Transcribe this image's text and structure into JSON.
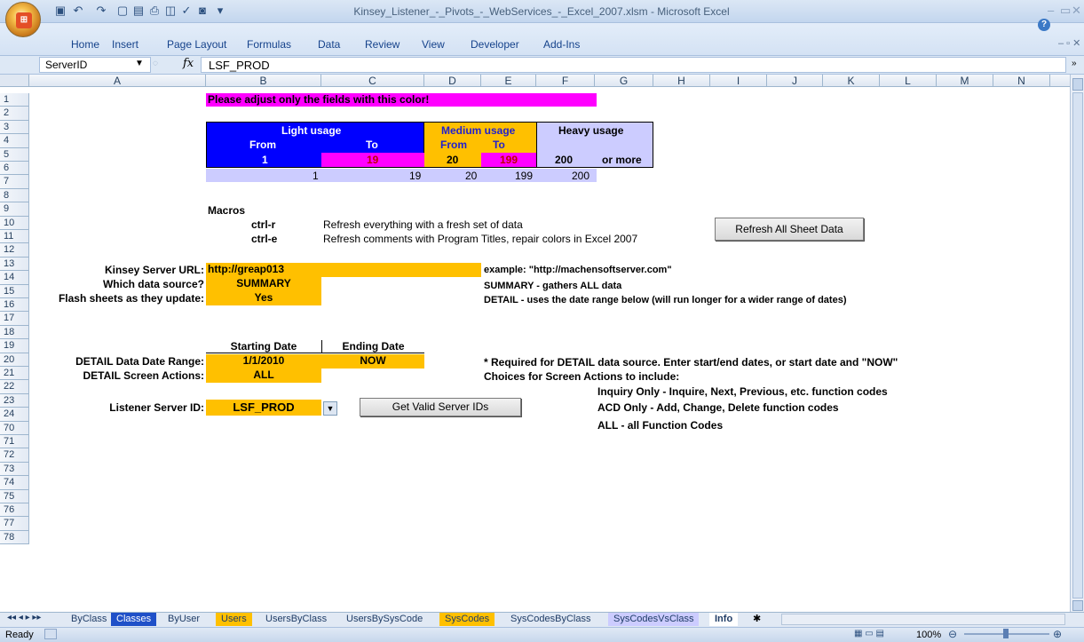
{
  "window": {
    "title": "Kinsey_Listener_-_Pivots_-_WebServices_-_Excel_2007.xlsm - Microsoft Excel",
    "controls": [
      "–",
      "▭",
      "✕"
    ]
  },
  "ribbon": {
    "tabs": [
      "Home",
      "Insert",
      "Page Layout",
      "Formulas",
      "Data",
      "Review",
      "View",
      "Developer",
      "Add-Ins"
    ]
  },
  "formula_bar": {
    "name_box": "ServerID",
    "fx": "fx",
    "formula": "LSF_PROD"
  },
  "columns": [
    "A",
    "B",
    "C",
    "D",
    "E",
    "F",
    "G",
    "H",
    "I",
    "J",
    "K",
    "L",
    "M",
    "N"
  ],
  "rows": [
    "1",
    "2",
    "3",
    "4",
    "5",
    "6",
    "7",
    "8",
    "9",
    "10",
    "11",
    "12",
    "13",
    "14",
    "15",
    "16",
    "17",
    "18",
    "19",
    "20",
    "21",
    "22",
    "23",
    "24",
    "70",
    "71",
    "72",
    "73",
    "74",
    "75",
    "76",
    "77",
    "78"
  ],
  "sheet": {
    "notice": "Please adjust only the fields with this color!",
    "usage": {
      "light_header": "Light usage",
      "medium_header": "Medium usage",
      "heavy_header": "Heavy usage",
      "from": "From",
      "to": "To",
      "light_from": "1",
      "light_to": "19",
      "medium_from": "20",
      "medium_to": "199",
      "heavy_from": "200",
      "or_more": "or more",
      "row6": [
        "1",
        "19",
        "20",
        "199",
        "200"
      ]
    },
    "macros": {
      "label": "Macros",
      "items": [
        {
          "key": "ctrl-r",
          "desc": "Refresh everything with a fresh set of data"
        },
        {
          "key": "ctrl-e",
          "desc": "Refresh comments with Program Titles, repair colors in Excel 2007"
        }
      ]
    },
    "refresh_button": "Refresh All Sheet Data",
    "server_url_label": "Kinsey Server URL:",
    "server_url_value": "http://greap013",
    "server_url_example": "example:  \"http://machensoftserver.com\"",
    "data_source_label": "Which data source?",
    "data_source_value": "SUMMARY",
    "summary_note": "SUMMARY - gathers ALL data",
    "flash_label": "Flash sheets as they update:",
    "flash_value": "Yes",
    "detail_note": "DETAIL - uses the date range below (will run longer for a wider range of dates)",
    "starting_date_header": "Starting Date",
    "ending_date_header": "Ending Date",
    "date_range_label": "DETAIL Data Date Range:",
    "start_date": "1/1/2010",
    "end_date": "NOW",
    "date_note": "* Required for DETAIL data source. Enter start/end dates, or start date and \"NOW\"",
    "screen_actions_label": "DETAIL Screen Actions:",
    "screen_actions_value": "ALL",
    "choices_label": "Choices for Screen Actions to include:",
    "choice_inquiry": "Inquiry Only - Inquire, Next, Previous, etc. function codes",
    "choice_acd": "ACD Only - Add, Change, Delete function codes",
    "choice_all": "ALL - all Function Codes",
    "listener_label": "Listener Server ID:",
    "listener_value": "LSF_PROD",
    "valid_ids_button": "Get Valid Server IDs"
  },
  "sheet_tabs": [
    "ByClass",
    "Classes",
    "ByUser",
    "Users",
    "UsersByClass",
    "UsersBySysCode",
    "SysCodes",
    "SysCodesByClass",
    "SysCodesVsClass",
    "Info"
  ],
  "status": {
    "ready": "Ready",
    "zoom": "100%"
  },
  "colors": {
    "magenta": "#ff00ff",
    "orange": "#ffc000",
    "blue": "#0000ff",
    "lavender": "#ccccff"
  }
}
